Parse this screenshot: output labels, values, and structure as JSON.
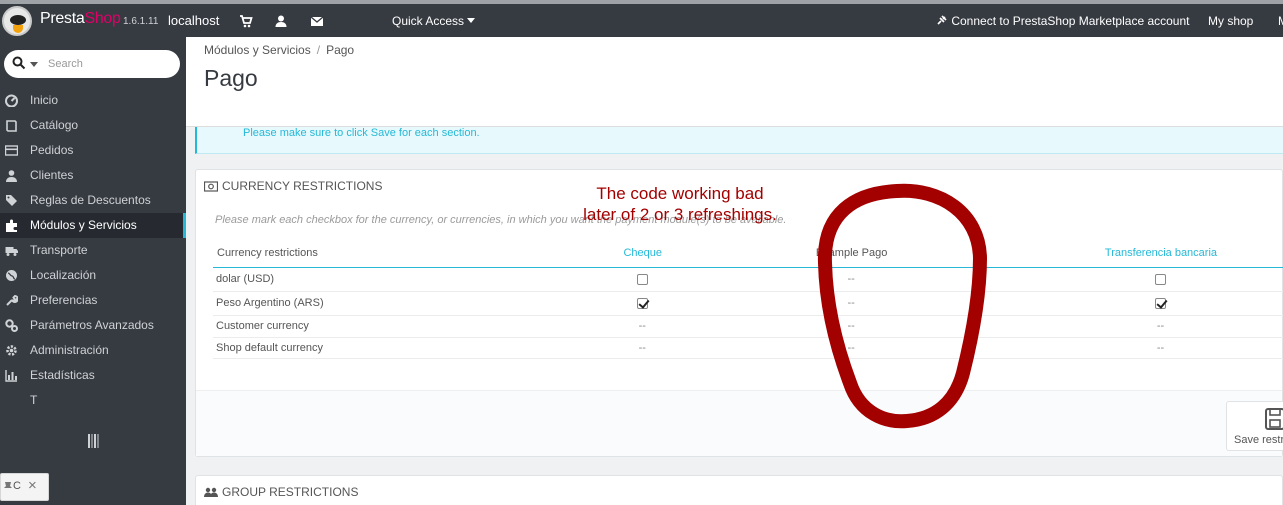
{
  "topbar": {
    "brand_presta": "Presta",
    "brand_shop": "Shop",
    "version": "1.6.1.11",
    "host": "localhost",
    "quick_access": "Quick Access",
    "connect": "Connect to PrestaShop Marketplace account",
    "my_shop": "My shop",
    "truncated": "M",
    "icons": [
      "cart-icon",
      "user-icon",
      "envelope-icon",
      "plug-icon"
    ]
  },
  "sidebar": {
    "search_placeholder": "Search",
    "items": [
      {
        "label": "Inicio",
        "icon": "dashboard-icon"
      },
      {
        "label": "Catálogo",
        "icon": "book-icon"
      },
      {
        "label": "Pedidos",
        "icon": "credit-card-icon"
      },
      {
        "label": "Clientes",
        "icon": "user-icon"
      },
      {
        "label": "Reglas de Descuentos",
        "icon": "tag-icon"
      },
      {
        "label": "Módulos y Servicios",
        "icon": "puzzle-icon",
        "active": true
      },
      {
        "label": "Transporte",
        "icon": "truck-icon"
      },
      {
        "label": "Localización",
        "icon": "globe-icon"
      },
      {
        "label": "Preferencias",
        "icon": "wrench-icon"
      },
      {
        "label": "Parámetros Avanzados",
        "icon": "cogs-icon"
      },
      {
        "label": "Administración",
        "icon": "cog-icon"
      },
      {
        "label": "Estadísticas",
        "icon": "bar-chart-icon"
      },
      {
        "label": "T",
        "icon": ""
      }
    ],
    "mini_widget_text": "C"
  },
  "breadcrumb": {
    "parent": "Módulos y Servicios",
    "separator": "/",
    "current": "Pago"
  },
  "page_title": "Pago",
  "info_alert": "Please make sure to click Save for each section.",
  "currency_panel": {
    "title": "CURRENCY RESTRICTIONS",
    "help": "Please mark each checkbox for the currency, or currencies, in which you want the payment module(s) to be available.",
    "columns": [
      "Currency restrictions",
      "Cheque",
      "Example Pago",
      "Transferencia bancaria"
    ],
    "rows": [
      {
        "name": "dolar (USD)",
        "cheque": "unchecked",
        "example": "--",
        "transfer": "unchecked"
      },
      {
        "name": "Peso Argentino (ARS)",
        "cheque": "checked",
        "example": "--",
        "transfer": "checked"
      },
      {
        "name": "Customer currency",
        "cheque": "--",
        "example": "--",
        "transfer": "--"
      },
      {
        "name": "Shop default currency",
        "cheque": "--",
        "example": "--",
        "transfer": "--"
      }
    ],
    "save_label": "Save restr"
  },
  "group_panel": {
    "title": "GROUP RESTRICTIONS"
  },
  "annotation": {
    "line1": "The code working bad",
    "line2": "later of 2 or 3 refreshings.",
    "color": "#a30000"
  },
  "colors": {
    "dark": "#363a41",
    "accent": "#25b9d7",
    "brand_pink": "#df0067"
  }
}
